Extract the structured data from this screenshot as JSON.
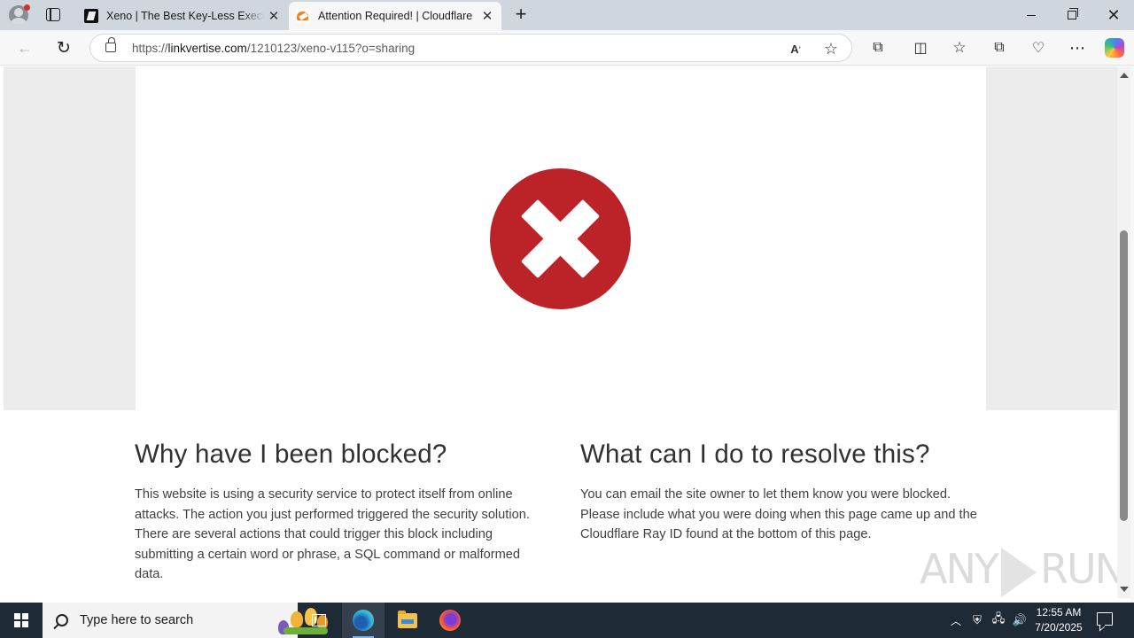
{
  "browser": {
    "tabs": [
      {
        "title": "Xeno | The Best Key-Less Executor",
        "active": false
      },
      {
        "title": "Attention Required! | Cloudflare",
        "active": true
      }
    ],
    "address": {
      "prefix": "https://",
      "host": "linkvertise.com",
      "path": "/1210123/xeno-v115?o=sharing"
    },
    "icons": {
      "back": "back-arrow-icon",
      "refresh": "refresh-icon",
      "read_aloud": "read-aloud-icon",
      "favorite": "star-icon",
      "extensions": "puzzle-icon",
      "split": "split-screen-icon",
      "favorites": "favorites-icon",
      "collections": "collections-icon",
      "performance": "heart-pulse-icon",
      "more": "ellipsis-icon",
      "copilot": "copilot-icon"
    }
  },
  "page": {
    "accent": "#bc2329",
    "left": {
      "heading": "Why have I been blocked?",
      "body": "This website is using a security service to protect itself from online attacks. The action you just performed triggered the security solution. There are several actions that could trigger this block including submitting a certain word or phrase, a SQL command or malformed data."
    },
    "right": {
      "heading": "What can I do to resolve this?",
      "body": "You can email the site owner to let them know you were blocked. Please include what you were doing when this page came up and the Cloudflare Ray ID found at the bottom of this page."
    },
    "watermark": {
      "left": "ANY",
      "right": "RUN"
    }
  },
  "taskbar": {
    "search_placeholder": "Type here to search",
    "time": "12:55 AM",
    "date": "7/20/2025"
  }
}
